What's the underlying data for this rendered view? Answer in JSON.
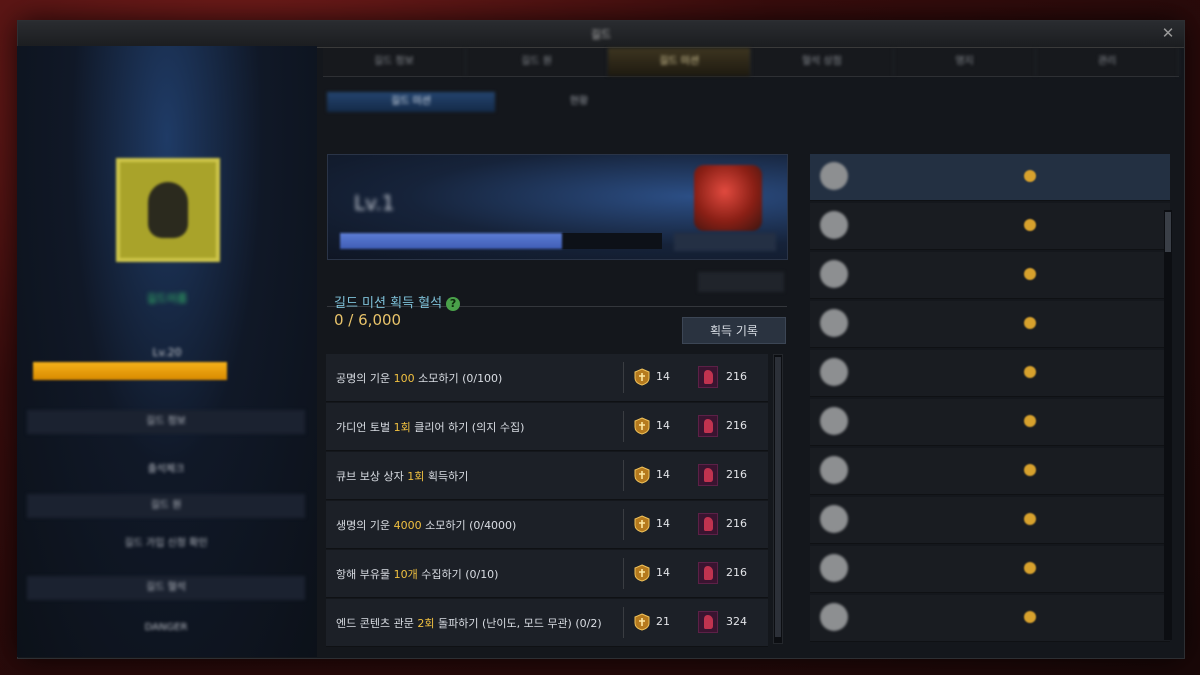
{
  "window": {
    "title": "길드"
  },
  "left_panel": {
    "guild_name": "길드이름",
    "level": "Lv.20",
    "xp_text": "",
    "menu": [
      "길드 정보",
      "출석체크",
      "길드 원",
      "길드 가입 신청 확인",
      "길드 혈석",
      "DANGER"
    ]
  },
  "tabs": [
    "길드 정보",
    "길드 원",
    "길드 미션",
    "혈석 상점",
    "영지",
    "관리"
  ],
  "active_tab": 2,
  "subtabs": [
    "길드 미션",
    "현황"
  ],
  "notice": "",
  "banner": {
    "label": "Lv.1",
    "progress": 0.69,
    "button": ""
  },
  "hint": "",
  "mission_section": {
    "title": "길드 미션 획득 혈석",
    "help": "?",
    "progress_text": "0 / 6,000",
    "history_button": "획득 기록"
  },
  "missions": [
    {
      "pre": "공명의 기운 ",
      "hl": "100",
      "post": " 소모하기 (0/100)",
      "reward1": "14",
      "reward2": "216"
    },
    {
      "pre": "가디언 토벌 ",
      "hl": "1회",
      "post": " 클리어 하기 (의지 수집)",
      "reward1": "14",
      "reward2": "216"
    },
    {
      "pre": "큐브 보상 상자 ",
      "hl": "1회",
      "post": " 획득하기",
      "reward1": "14",
      "reward2": "216"
    },
    {
      "pre": "생명의 기운 ",
      "hl": "4000",
      "post": " 소모하기 (0/4000)",
      "reward1": "14",
      "reward2": "216"
    },
    {
      "pre": "항해 부유물 ",
      "hl": "10개",
      "post": " 수집하기 (0/10)",
      "reward1": "14",
      "reward2": "216"
    },
    {
      "pre": "엔드 콘텐츠 관문 ",
      "hl": "2회",
      "post": " 돌파하기 (난이도, 모드 무관) (0/2)",
      "reward1": "21",
      "reward2": "324"
    }
  ],
  "ranking": {
    "header": "",
    "items": [
      {
        "name": "",
        "sub": "",
        "value": ""
      },
      {
        "name": "",
        "sub": "",
        "value": ""
      },
      {
        "name": "",
        "sub": "",
        "value": ""
      },
      {
        "name": "",
        "sub": "",
        "value": ""
      },
      {
        "name": "",
        "sub": "",
        "value": ""
      },
      {
        "name": "",
        "sub": "",
        "value": ""
      },
      {
        "name": "",
        "sub": "",
        "value": ""
      },
      {
        "name": "",
        "sub": "",
        "value": ""
      },
      {
        "name": "",
        "sub": "",
        "value": ""
      },
      {
        "name": "",
        "sub": "",
        "value": ""
      }
    ]
  },
  "colors": {
    "highlight": "#f0c040",
    "title": "#7ec0d8",
    "progress": "#e8c36a"
  }
}
